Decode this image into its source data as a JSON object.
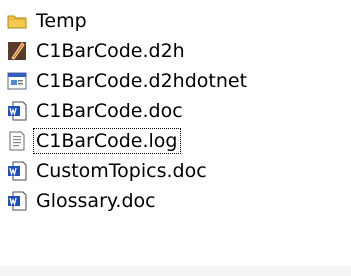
{
  "files": [
    {
      "name": "Temp",
      "icon": "folder-icon",
      "focused": false
    },
    {
      "name": "C1BarCode.d2h",
      "icon": "quill-pen-icon",
      "focused": false
    },
    {
      "name": "C1BarCode.d2hdotnet",
      "icon": "application-window-icon",
      "focused": false
    },
    {
      "name": "C1BarCode.doc",
      "icon": "word-document-icon",
      "focused": false
    },
    {
      "name": "C1BarCode.log",
      "icon": "text-document-icon",
      "focused": true
    },
    {
      "name": "CustomTopics.doc",
      "icon": "word-document-icon",
      "focused": false
    },
    {
      "name": "Glossary.doc",
      "icon": "word-document-icon",
      "focused": false
    }
  ],
  "colors": {
    "folder": "#f2c94c",
    "word_blue": "#1f4fbf",
    "quill_orange": "#e07a1f"
  }
}
